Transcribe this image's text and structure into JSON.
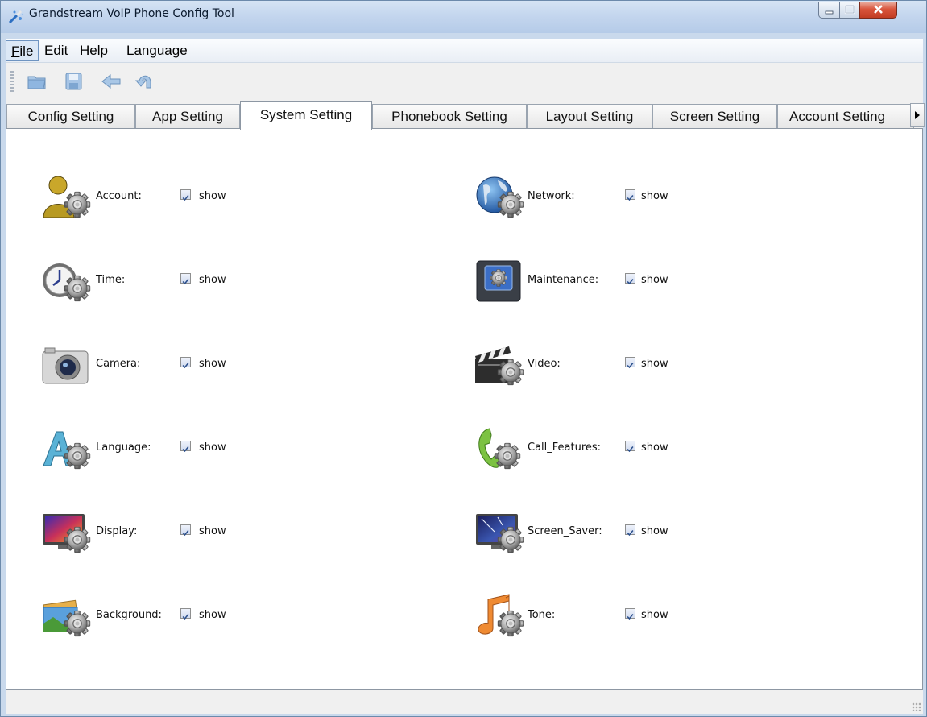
{
  "window": {
    "title": "Grandstream VoIP Phone Config Tool",
    "icons": {
      "app": "tools-wand-icon",
      "minimize": "minimize-icon",
      "maximize": "maximize-icon",
      "close": "close-icon"
    }
  },
  "menu": {
    "file_u": "F",
    "file_rest": "ile",
    "edit_u": "E",
    "edit_rest": "dit",
    "help_u": "H",
    "help_rest": "elp",
    "language_u": "L",
    "language_rest": "anguage"
  },
  "toolbar": {
    "icons": [
      "open-folder-icon",
      "save-icon",
      "back-arrow-icon",
      "undo-icon"
    ]
  },
  "tabs": [
    {
      "label": "Config Setting"
    },
    {
      "label": "App Setting"
    },
    {
      "label": "System Setting",
      "active": true
    },
    {
      "label": "Phonebook Setting"
    },
    {
      "label": "Layout Setting"
    },
    {
      "label": "Screen Setting"
    },
    {
      "label": "Account Setting"
    }
  ],
  "settings": {
    "left": [
      {
        "label": "Account:",
        "icon": "account-gear-icon",
        "checked": true,
        "check_label": "show"
      },
      {
        "label": "Time:",
        "icon": "clock-gear-icon",
        "checked": true,
        "check_label": "show"
      },
      {
        "label": "Camera:",
        "icon": "camera-icon",
        "checked": true,
        "check_label": "show"
      },
      {
        "label": "Language:",
        "icon": "language-gear-icon",
        "checked": true,
        "check_label": "show"
      },
      {
        "label": "Display:",
        "icon": "display-gear-icon",
        "checked": true,
        "check_label": "show"
      },
      {
        "label": "Background:",
        "icon": "background-gear-icon",
        "checked": true,
        "check_label": "show"
      }
    ],
    "right": [
      {
        "label": "Network:",
        "icon": "globe-gear-icon",
        "checked": true,
        "check_label": "show"
      },
      {
        "label": "Maintenance:",
        "icon": "maintenance-gear-icon",
        "checked": true,
        "check_label": "show"
      },
      {
        "label": "Video:",
        "icon": "clapperboard-gear-icon",
        "checked": true,
        "check_label": "show"
      },
      {
        "label": "Call_Features:",
        "icon": "phone-gear-icon",
        "checked": true,
        "check_label": "show"
      },
      {
        "label": "Screen_Saver:",
        "icon": "screen-saver-gear-icon",
        "checked": true,
        "check_label": "show"
      },
      {
        "label": "Tone:",
        "icon": "music-note-gear-icon",
        "checked": true,
        "check_label": "show"
      }
    ]
  },
  "colors": {
    "titlebar": "#c4d6ee",
    "close_button": "#c13c22",
    "checkbox_tick": "#2b4f8c",
    "gear": "#8a8a8a"
  }
}
